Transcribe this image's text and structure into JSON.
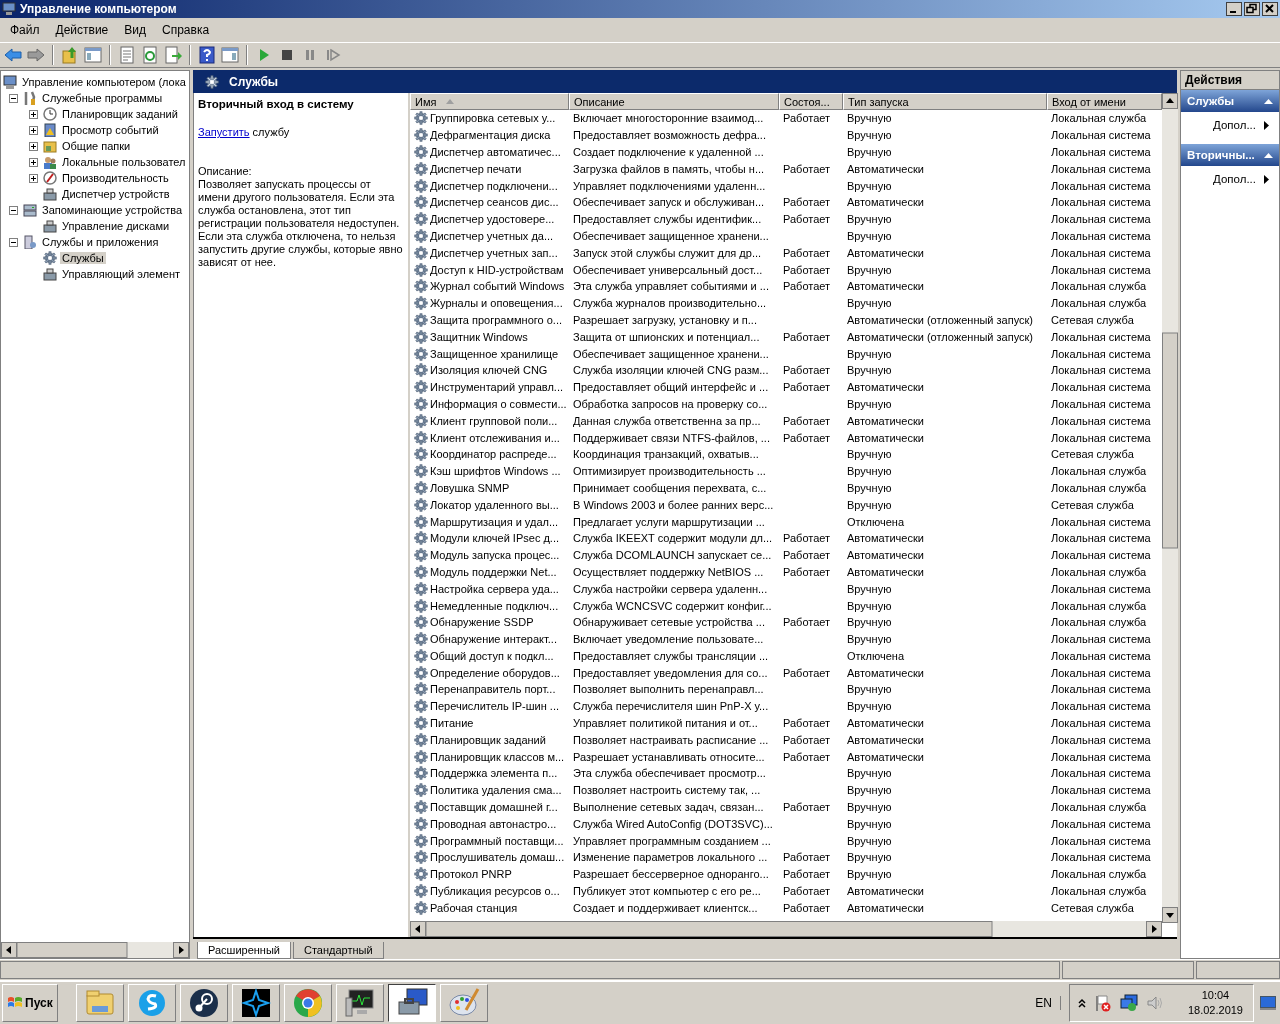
{
  "window": {
    "title": "Управление компьютером"
  },
  "menu": [
    "Файл",
    "Действие",
    "Вид",
    "Справка"
  ],
  "tree": {
    "label": "Управление компьютером (лока",
    "kind": "computer",
    "selected": false,
    "children": [
      {
        "label": "Служебные программы",
        "kind": "tools",
        "expanded": true,
        "selected": false,
        "children": [
          {
            "label": "Планировщик заданий",
            "kind": "clock",
            "expanded": false,
            "selected": false
          },
          {
            "label": "Просмотр событий",
            "kind": "log",
            "expanded": false,
            "selected": false
          },
          {
            "label": "Общие папки",
            "kind": "folder",
            "expanded": false,
            "selected": false
          },
          {
            "label": "Локальные пользовател",
            "kind": "users",
            "expanded": false,
            "selected": false
          },
          {
            "label": "Производительность",
            "kind": "gauge",
            "expanded": false,
            "selected": false
          },
          {
            "label": "Диспетчер устройств",
            "kind": "device",
            "selected": false
          }
        ]
      },
      {
        "label": "Запоминающие устройства",
        "kind": "storage",
        "expanded": true,
        "selected": false,
        "children": [
          {
            "label": "Управление дисками",
            "kind": "device",
            "selected": false
          }
        ]
      },
      {
        "label": "Службы и приложения",
        "kind": "apps",
        "expanded": true,
        "selected": false,
        "children": [
          {
            "label": "Службы",
            "kind": "gear",
            "selected": true
          },
          {
            "label": "Управляющий элемент",
            "kind": "device",
            "selected": false
          }
        ]
      }
    ]
  },
  "pane_header": {
    "title": "Службы"
  },
  "details": {
    "title": "Вторичный вход в систему",
    "action_link": "Запустить",
    "action_rest": "службу",
    "description_label": "Описание:",
    "description": "Позволяет запускать процессы от имени другого пользователя. Если эта служба остановлена, этот тип регистрации пользователя недоступен. Если эта служба отключена, то нельзя запустить другие службы, которые явно зависят от нее."
  },
  "table": {
    "columns": [
      {
        "label": "Имя",
        "sorted": true
      },
      {
        "label": "Описание",
        "sorted": false
      },
      {
        "label": "Состоя...",
        "sorted": false
      },
      {
        "label": "Тип запуска",
        "sorted": false
      },
      {
        "label": "Вход от имени",
        "sorted": false
      }
    ],
    "rows": [
      {
        "name": "Группировка сетевых у...",
        "description": "Включает многосторонние взаимод...",
        "status": "Работает",
        "startup": "Вручную",
        "logon": "Локальная служба"
      },
      {
        "name": "Дефрагментация диска",
        "description": "Предоставляет возможность дефра...",
        "startup": "Вручную",
        "logon": "Локальная система"
      },
      {
        "name": "Диспетчер автоматичес...",
        "description": "Создает подключение к удаленной ...",
        "startup": "Вручную",
        "logon": "Локальная система"
      },
      {
        "name": "Диспетчер печати",
        "description": "Загрузка файлов в память, чтобы н...",
        "status": "Работает",
        "startup": "Автоматически",
        "logon": "Локальная система"
      },
      {
        "name": "Диспетчер подключени...",
        "description": "Управляет подключениями удаленн...",
        "startup": "Вручную",
        "logon": "Локальная система"
      },
      {
        "name": "Диспетчер сеансов дис...",
        "description": "Обеспечивает запуск и обслуживан...",
        "status": "Работает",
        "startup": "Автоматически",
        "logon": "Локальная система"
      },
      {
        "name": "Диспетчер удостовере...",
        "description": "Предоставляет службы идентифик...",
        "status": "Работает",
        "startup": "Вручную",
        "logon": "Локальная система"
      },
      {
        "name": "Диспетчер учетных да...",
        "description": "Обеспечивает защищенное хранени...",
        "startup": "Вручную",
        "logon": "Локальная система"
      },
      {
        "name": "Диспетчер учетных зап...",
        "description": "Запуск этой службы служит для др...",
        "status": "Работает",
        "startup": "Автоматически",
        "logon": "Локальная система"
      },
      {
        "name": "Доступ к HID-устройствам",
        "description": "Обеспечивает универсальный дост...",
        "status": "Работает",
        "startup": "Вручную",
        "logon": "Локальная система"
      },
      {
        "name": "Журнал событий Windows",
        "description": "Эта служба управляет событиями и ...",
        "status": "Работает",
        "startup": "Автоматически",
        "logon": "Локальная служба"
      },
      {
        "name": "Журналы и оповещения...",
        "description": "Служба журналов производительно...",
        "startup": "Вручную",
        "logon": "Локальная служба"
      },
      {
        "name": "Защита программного о...",
        "description": "Разрешает загрузку, установку и п...",
        "startup": "Автоматически (отложенный запуск)",
        "logon": "Сетевая служба"
      },
      {
        "name": "Защитник Windows",
        "description": "Защита от шпионских и потенциал...",
        "status": "Работает",
        "startup": "Автоматически (отложенный запуск)",
        "logon": "Локальная система"
      },
      {
        "name": "Защищенное хранилище",
        "description": "Обеспечивает защищенное хранени...",
        "startup": "Вручную",
        "logon": "Локальная система"
      },
      {
        "name": "Изоляция ключей CNG",
        "description": "Служба изоляции ключей CNG разм...",
        "status": "Работает",
        "startup": "Вручную",
        "logon": "Локальная система"
      },
      {
        "name": "Инструментарий управл...",
        "description": "Предоставляет общий интерфейс и ...",
        "status": "Работает",
        "startup": "Автоматически",
        "logon": "Локальная система"
      },
      {
        "name": "Информация о совмести...",
        "description": "Обработка запросов на проверку со...",
        "startup": "Вручную",
        "logon": "Локальная система"
      },
      {
        "name": "Клиент групповой поли...",
        "description": "Данная служба ответственна за пр...",
        "status": "Работает",
        "startup": "Автоматически",
        "logon": "Локальная система"
      },
      {
        "name": "Клиент отслеживания и...",
        "description": "Поддерживает связи NTFS-файлов, ...",
        "status": "Работает",
        "startup": "Автоматически",
        "logon": "Локальная система"
      },
      {
        "name": "Координатор распреде...",
        "description": "Координация транзакций, охватыв...",
        "startup": "Вручную",
        "logon": "Сетевая служба"
      },
      {
        "name": "Кэш шрифтов Windows ...",
        "description": "Оптимизирует производительность ...",
        "startup": "Вручную",
        "logon": "Локальная служба"
      },
      {
        "name": "Ловушка SNMP",
        "description": "Принимает сообщения перехвата, с...",
        "startup": "Вручную",
        "logon": "Локальная служба"
      },
      {
        "name": "Локатор удаленного вы...",
        "description": "В Windows 2003 и более ранних верс...",
        "startup": "Вручную",
        "logon": "Сетевая служба"
      },
      {
        "name": "Маршрутизация и удал...",
        "description": "Предлагает услуги маршрутизации ...",
        "startup": "Отключена",
        "logon": "Локальная система"
      },
      {
        "name": "Модули ключей IPsec д...",
        "description": "Служба IKEEXT содержит модули дл...",
        "status": "Работает",
        "startup": "Автоматически",
        "logon": "Локальная система"
      },
      {
        "name": "Модуль запуска процес...",
        "description": "Служба DCOMLAUNCH запускает се...",
        "status": "Работает",
        "startup": "Автоматически",
        "logon": "Локальная система"
      },
      {
        "name": "Модуль поддержки Net...",
        "description": "Осуществляет поддержку NetBIOS ...",
        "status": "Работает",
        "startup": "Автоматически",
        "logon": "Локальная служба"
      },
      {
        "name": "Настройка сервера уда...",
        "description": "Служба настройки сервера удаленн...",
        "startup": "Вручную",
        "logon": "Локальная система"
      },
      {
        "name": "Немедленные подключ...",
        "description": "Служба WCNCSVC содержит конфиг...",
        "startup": "Вручную",
        "logon": "Локальная служба"
      },
      {
        "name": "Обнаружение SSDP",
        "description": "Обнаруживает сетевые устройства ...",
        "status": "Работает",
        "startup": "Вручную",
        "logon": "Локальная служба"
      },
      {
        "name": "Обнаружение интеракт...",
        "description": "Включает уведомление пользовате...",
        "startup": "Вручную",
        "logon": "Локальная система"
      },
      {
        "name": "Общий доступ к подкл...",
        "description": "Предоставляет службы трансляции ...",
        "startup": "Отключена",
        "logon": "Локальная система"
      },
      {
        "name": "Определение оборудов...",
        "description": "Предоставляет уведомления для со...",
        "status": "Работает",
        "startup": "Автоматически",
        "logon": "Локальная система"
      },
      {
        "name": "Перенаправитель порт...",
        "description": "Позволяет выполнить перенаправл...",
        "startup": "Вручную",
        "logon": "Локальная система"
      },
      {
        "name": "Перечислитель IP-шин ...",
        "description": "Служба перечислителя шин PnP-X у...",
        "startup": "Вручную",
        "logon": "Локальная система"
      },
      {
        "name": "Питание",
        "description": "Управляет политикой питания и от...",
        "status": "Работает",
        "startup": "Автоматически",
        "logon": "Локальная система"
      },
      {
        "name": "Планировщик заданий",
        "description": "Позволяет настраивать расписание ...",
        "status": "Работает",
        "startup": "Автоматически",
        "logon": "Локальная система"
      },
      {
        "name": "Планировщик классов м...",
        "description": "Разрешает устанавливать относите...",
        "status": "Работает",
        "startup": "Автоматически",
        "logon": "Локальная система"
      },
      {
        "name": "Поддержка элемента п...",
        "description": "Эта служба обеспечивает просмотр...",
        "startup": "Вручную",
        "logon": "Локальная система"
      },
      {
        "name": "Политика удаления сма...",
        "description": "Позволяет настроить систему так, ...",
        "startup": "Вручную",
        "logon": "Локальная система"
      },
      {
        "name": "Поставщик домашней г...",
        "description": "Выполнение сетевых задач, связан...",
        "status": "Работает",
        "startup": "Вручную",
        "logon": "Локальная служба"
      },
      {
        "name": "Проводная автонастро...",
        "description": "Служба Wired AutoConfig (DOT3SVC)...",
        "startup": "Вручную",
        "logon": "Локальная система"
      },
      {
        "name": "Программный поставщи...",
        "description": "Управляет программным созданием ...",
        "startup": "Вручную",
        "logon": "Локальная система"
      },
      {
        "name": "Прослушиватель домаш...",
        "description": "Изменение параметров локального ...",
        "status": "Работает",
        "startup": "Вручную",
        "logon": "Локальная система"
      },
      {
        "name": "Протокол PNRP",
        "description": "Разрешает бессерверное одноранго...",
        "status": "Работает",
        "startup": "Вручную",
        "logon": "Локальная служба"
      },
      {
        "name": "Публикация ресурсов о...",
        "description": "Публикует этот компьютер с его ре...",
        "status": "Работает",
        "startup": "Автоматически",
        "logon": "Локальная служба"
      },
      {
        "name": "Рабочая станция",
        "description": "Создает и поддерживает клиентск...",
        "status": "Работает",
        "startup": "Автоматически",
        "logon": "Сетевая служба"
      }
    ]
  },
  "view_tabs": [
    {
      "label": "Расширенный",
      "selected": true
    },
    {
      "label": "Стандартный",
      "selected": false
    }
  ],
  "actions": {
    "title": "Действия",
    "sections": [
      {
        "title": "Службы",
        "expanded": true,
        "items": [
          "Допол..."
        ]
      },
      {
        "title": "Вторичны...",
        "expanded": true,
        "items": [
          "Допол..."
        ]
      }
    ]
  },
  "taskbar": {
    "start": "Пуск",
    "apps": [
      {
        "kind": "folder",
        "selected": false
      },
      {
        "kind": "chat",
        "selected": false
      },
      {
        "kind": "steam",
        "selected": false
      },
      {
        "kind": "star",
        "selected": false
      },
      {
        "kind": "browser",
        "selected": false
      },
      {
        "kind": "monitor",
        "selected": false
      },
      {
        "kind": "toolbox",
        "selected": true
      },
      {
        "kind": "palette",
        "selected": false
      }
    ],
    "language": "EN",
    "time": "10:04",
    "date": "18.02.2019"
  }
}
